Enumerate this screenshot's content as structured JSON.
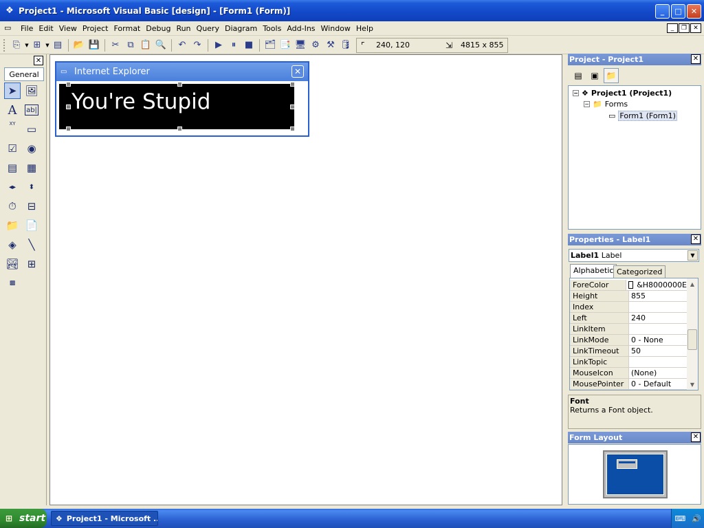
{
  "window": {
    "title": "Project1 - Microsoft Visual Basic [design] - [Form1 (Form)]",
    "app_icon": "vb-project-icon",
    "minimize": "_",
    "maximize": "□",
    "close": "✕"
  },
  "menu": {
    "items": [
      "File",
      "Edit",
      "View",
      "Project",
      "Format",
      "Debug",
      "Run",
      "Query",
      "Diagram",
      "Tools",
      "Add-Ins",
      "Window",
      "Help"
    ],
    "mdi_minimize": "_",
    "mdi_restore": "❐",
    "mdi_close": "✕"
  },
  "toolbar": {
    "position_readout": "240, 120",
    "size_readout": "4815 x 855"
  },
  "toolbox": {
    "close": "✕",
    "tab_label": "General",
    "text_tool_glyph": "A",
    "textbox_glyph": "ab|",
    "frame_glyph": "XY"
  },
  "form": {
    "title": "Internet Explorer",
    "close": "✕",
    "label_caption": "You're Stupid"
  },
  "project_panel": {
    "title": "Project - Project1",
    "close": "✕",
    "tree": {
      "root": "Project1 (Project1)",
      "folder": "Forms",
      "item": "Form1 (Form1)"
    }
  },
  "properties_panel": {
    "title": "Properties - Label1",
    "close": "✕",
    "object_name": "Label1",
    "object_type": "Label",
    "tabs": [
      "Alphabetic",
      "Categorized"
    ],
    "rows": [
      {
        "name": "ForeColor",
        "value": "&H8000000E"
      },
      {
        "name": "Height",
        "value": "855"
      },
      {
        "name": "Index",
        "value": ""
      },
      {
        "name": "Left",
        "value": "240"
      },
      {
        "name": "LinkItem",
        "value": ""
      },
      {
        "name": "LinkMode",
        "value": "0 - None"
      },
      {
        "name": "LinkTimeout",
        "value": "50"
      },
      {
        "name": "LinkTopic",
        "value": ""
      },
      {
        "name": "MouseIcon",
        "value": "(None)"
      },
      {
        "name": "MousePointer",
        "value": "0 - Default"
      }
    ],
    "description_title": "Font",
    "description_text": "Returns a Font object."
  },
  "form_layout_panel": {
    "title": "Form Layout",
    "close": "✕"
  },
  "taskbar": {
    "start_label": "start",
    "task_label": "Project1 - Microsoft ..."
  },
  "colors": {
    "titlebar_blue": "#1248c8",
    "canvas_white": "#ffffff",
    "label_background": "#000000",
    "label_foreground": "#ffffff",
    "panel_header": "#7a9ad6",
    "start_green": "#2f8a2f"
  }
}
